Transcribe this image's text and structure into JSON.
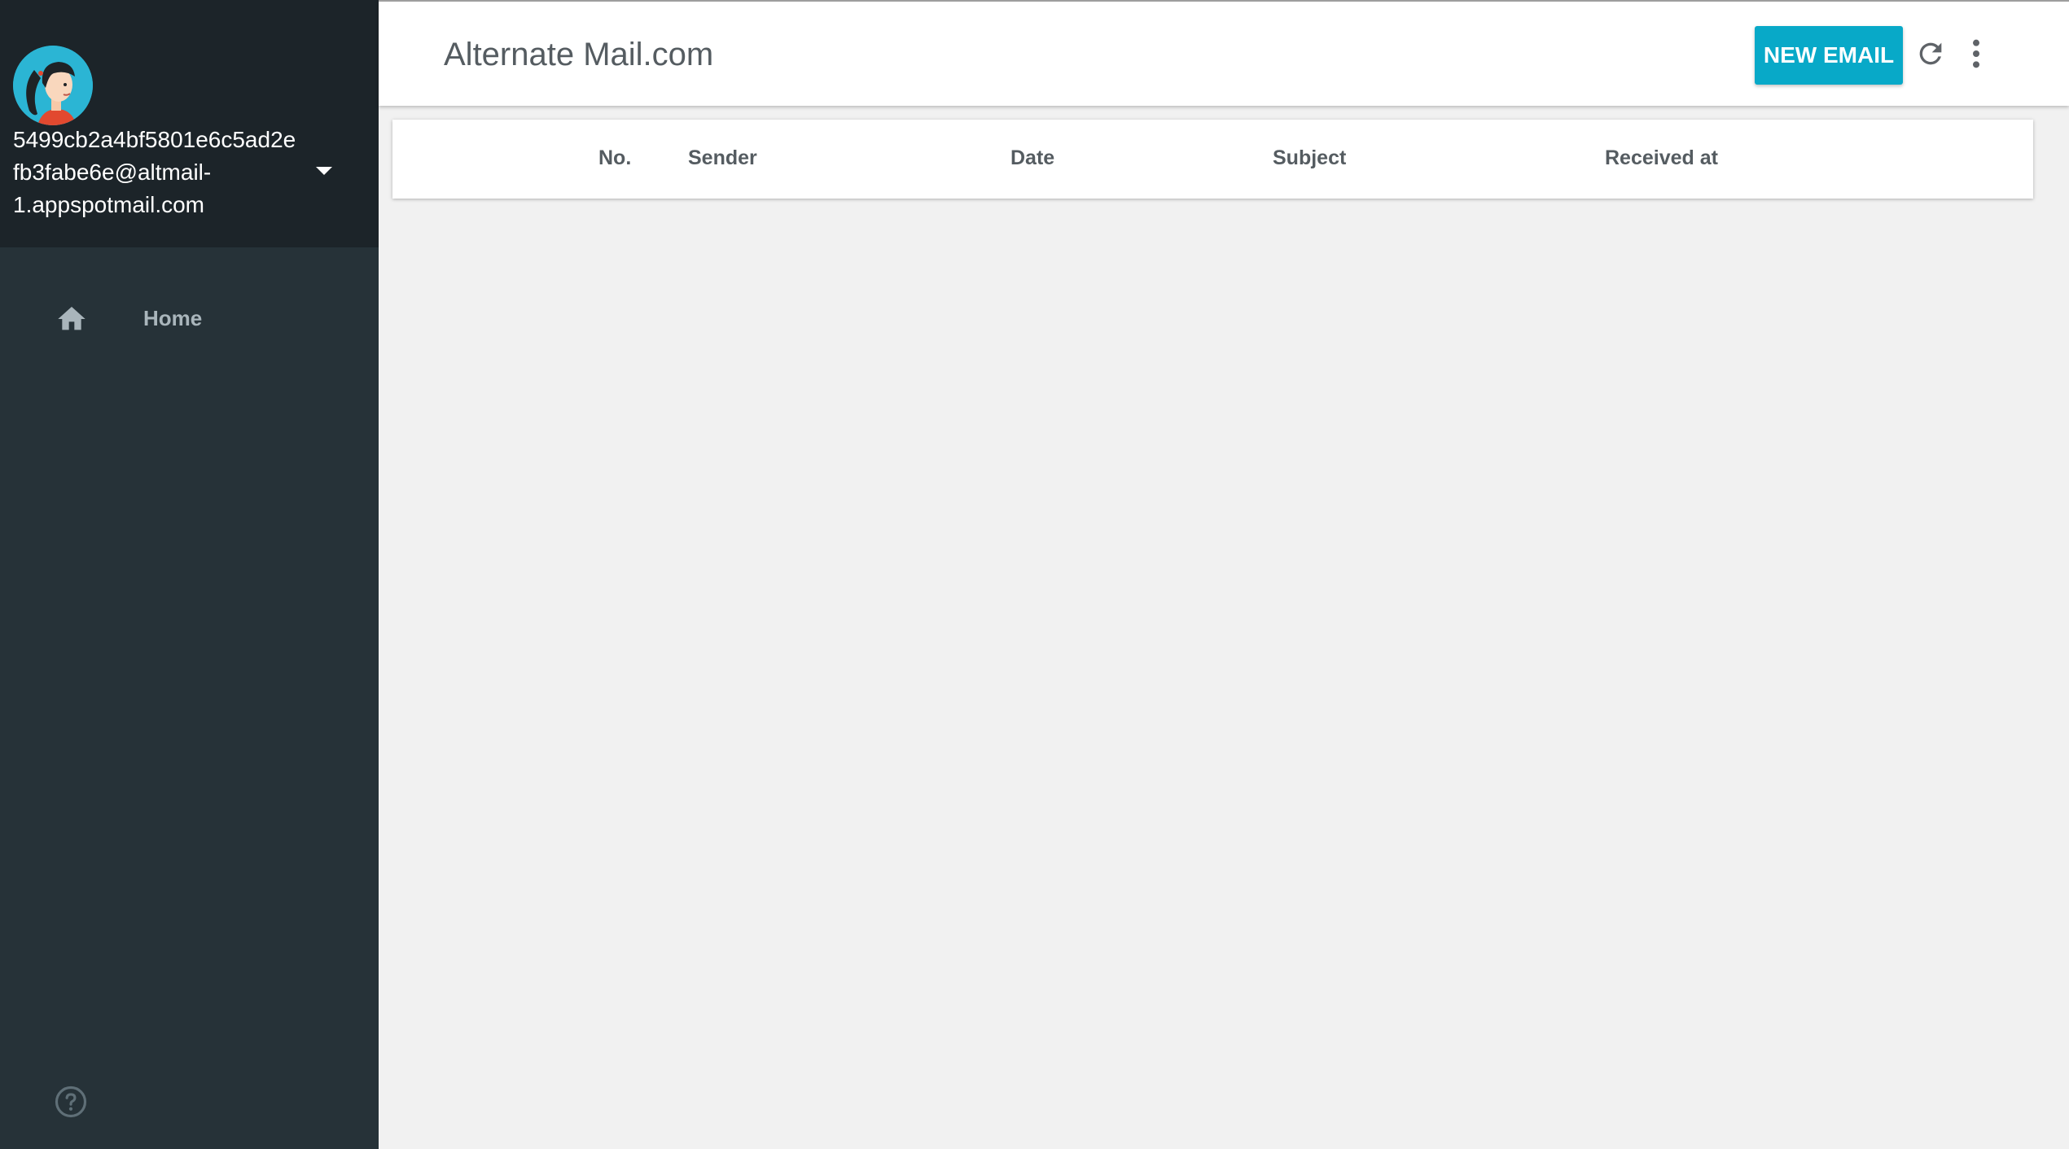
{
  "account": {
    "email": "5499cb2a4bf5801e6c5ad2e\nfb3fabe6e@altmail-\n1.appspotmail.com"
  },
  "nav": {
    "items": [
      {
        "label": "Home",
        "icon": "home-icon"
      }
    ],
    "help_icon": "help-circle-icon"
  },
  "header": {
    "title": "Alternate Mail.com",
    "new_email_label": "NEW EMAIL",
    "refresh_icon": "refresh-icon",
    "more_icon": "more-vert-icon"
  },
  "table": {
    "columns": [
      "No.",
      "Sender",
      "Date",
      "Subject",
      "Received at"
    ],
    "rows": []
  },
  "colors": {
    "sidebar_bg": "#263238",
    "account_bg": "#1c2429",
    "accent": "#08a9c8",
    "content_bg": "#f1f1f1"
  }
}
